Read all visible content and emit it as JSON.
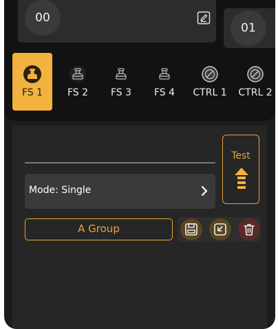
{
  "presets": [
    {
      "number": "00"
    },
    {
      "number": "01"
    }
  ],
  "switches": [
    {
      "label": "FS 1",
      "icon": "footswitch-icon",
      "active": true
    },
    {
      "label": "FS 2",
      "icon": "footswitch-icon",
      "active": false
    },
    {
      "label": "FS 3",
      "icon": "footswitch-icon",
      "active": false
    },
    {
      "label": "FS 4",
      "icon": "footswitch-icon",
      "active": false
    },
    {
      "label": "CTRL 1",
      "icon": "control-knob-icon",
      "active": false
    },
    {
      "label": "CTRL 2",
      "icon": "control-knob-icon",
      "active": false
    }
  ],
  "mode": {
    "label": "Mode: Single"
  },
  "test": {
    "label": "Test"
  },
  "group": {
    "label": "A Group"
  },
  "colors": {
    "accent": "#f3b23d",
    "background": "#1c1c1c",
    "panel": "#262626",
    "delete": "#5a2a28"
  }
}
